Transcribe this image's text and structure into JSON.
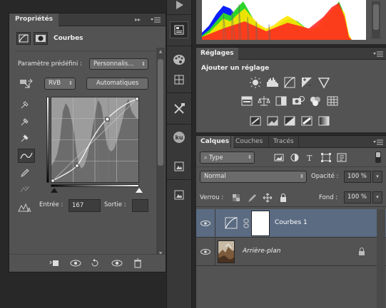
{
  "properties": {
    "tab_title": "Propriétés",
    "adjustment_name": "Courbes",
    "preset_label": "Paramètre prédéfini :",
    "preset_value": "Personnalis...",
    "channel_value": "RVB",
    "auto_button": "Automatiques",
    "input_label": "Entrée :",
    "input_value": "167",
    "output_label": "Sortie :",
    "output_value": ""
  },
  "adjustments": {
    "tab_title": "Réglages",
    "add_label": "Ajouter un réglage"
  },
  "layers": {
    "tabs": [
      "Calques",
      "Couches",
      "Tracés"
    ],
    "filter_value": "Type",
    "blend_mode": "Normal",
    "opacity_label": "Opacité :",
    "opacity_value": "100 %",
    "lock_label": "Verrou :",
    "fill_label": "Fond :",
    "fill_value": "100 %",
    "items": [
      {
        "name": "Courbes 1",
        "selected": true
      },
      {
        "name": "Arrière-plan",
        "selected": false
      }
    ]
  },
  "colors": {
    "panel_bg": "#535353",
    "selected_layer": "#5a6b82",
    "histogram_accent": "#ff0000"
  }
}
